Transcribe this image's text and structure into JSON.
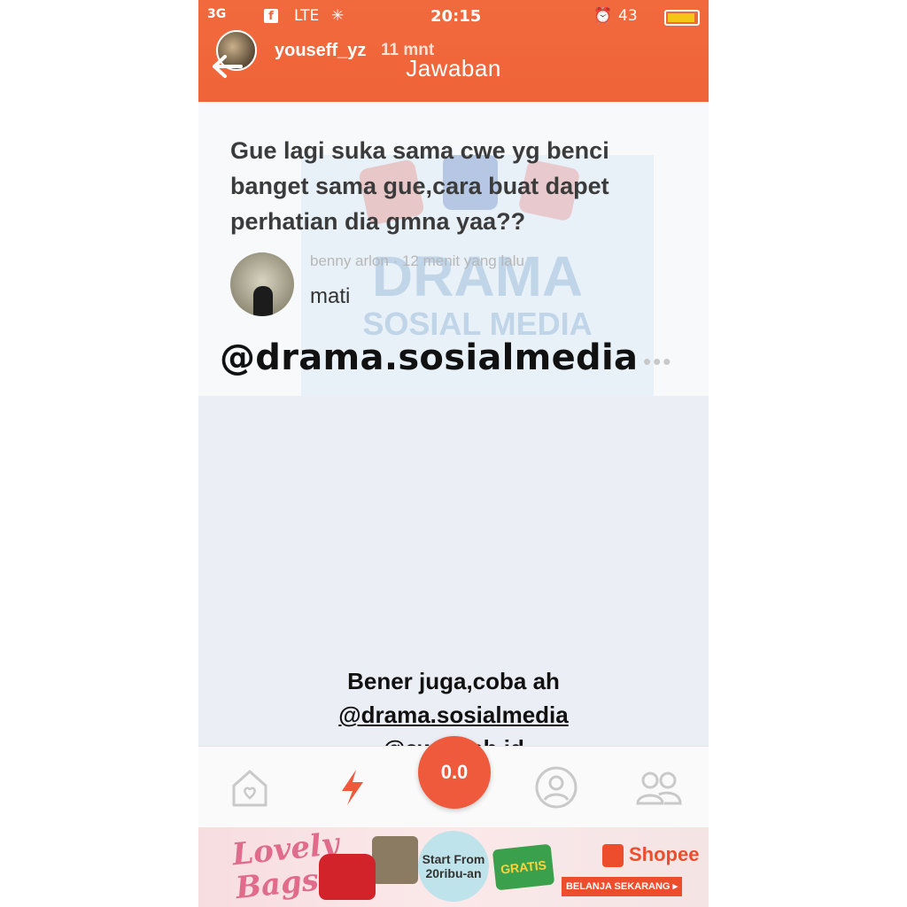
{
  "statusbar": {
    "carrier": "3G",
    "fb_badge": "f",
    "network": "LTE",
    "time": "20:15",
    "battery_pct": "43"
  },
  "story": {
    "username": "youseff_yz",
    "time_ago": "11 mnt"
  },
  "nav": {
    "title": "Jawaban"
  },
  "question": {
    "text": "Gue lagi suka sama cwe yg benci banget sama gue,cara buat dapet perhatian dia gmna yaa??"
  },
  "answer": {
    "meta": "benny arlon · 12 menit yang lalu",
    "text": "mati"
  },
  "watermark": {
    "line1": "DRAMA",
    "line2": "SOSIAL MEDIA"
  },
  "overlay": {
    "handle": "@drama.sosialmedia",
    "more": "•••"
  },
  "caption": {
    "line1": "Bener juga,coba ah",
    "line2": "@drama.sosialmedia",
    "line3": "@awreceh.id"
  },
  "tabbar": {
    "fab_label": "0.0"
  },
  "ad": {
    "lovely": "Lovely",
    "bags": "Bags",
    "start_from": "Start From",
    "price": "20ribu-an",
    "gratis": "GRATIS",
    "shopee": "Shopee",
    "cta": "BELANJA SEKARANG ▸"
  }
}
